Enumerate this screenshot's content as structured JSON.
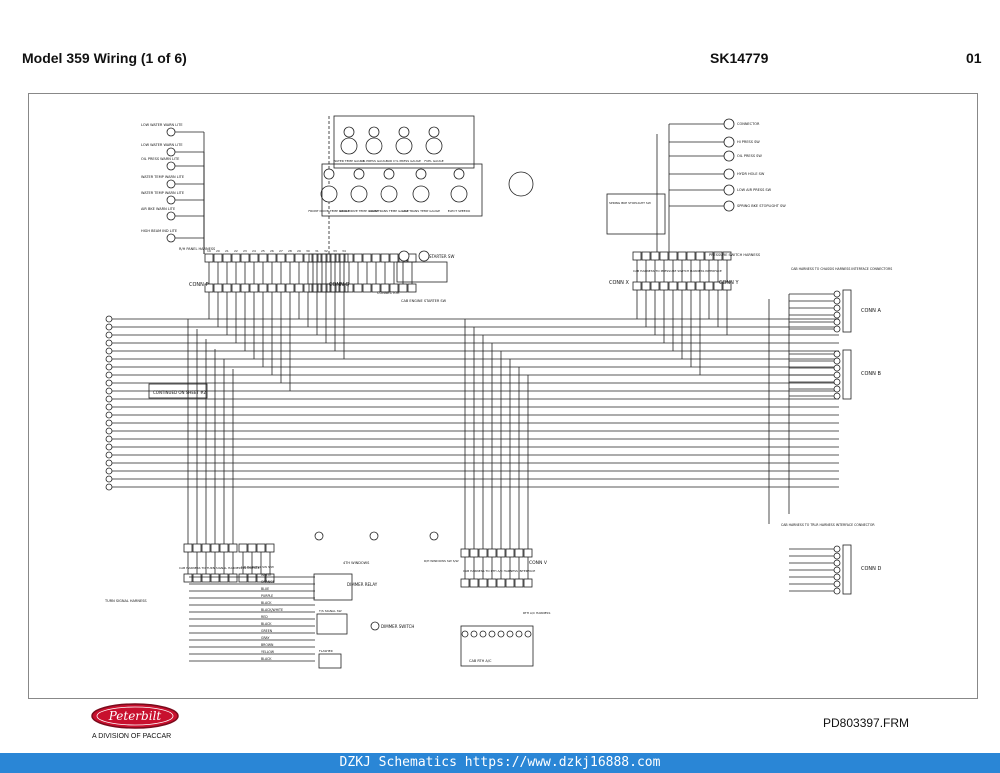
{
  "header": {
    "title": "Model 359 Wiring (1 of 6)",
    "code": "SK14779",
    "page": "01"
  },
  "brand": {
    "logo_text": "Peterbilt",
    "division": "A DIVISION OF PACCAR"
  },
  "file_name": "PD803397.FRM",
  "footer": "DZKJ Schematics https://www.dzkj16888.com",
  "schematic": {
    "left_labels": [
      "LOW WATER WARN LITE",
      "LOW WATER WARN LITE",
      "OIL PRESS WARN LITE",
      "WATER TEMP WARN LITE",
      "WATER TEMP WARN LITE",
      "AIR BKE WARN LITE",
      "HIGH BEAM IND LITE",
      "R/H PANEL HARNESS"
    ],
    "gauges": [
      "WATER TEMP GAUGE",
      "OIL PRESS GAUGE",
      "AIR CYL PRESS GAUGE",
      "FUEL GAUGE"
    ],
    "gauges_row2": [
      "FRONT DRIVE TEMP GAUGE",
      "REAR DRIVE TEMP GAUGE",
      "MAIN TRANS TEMP GAUGE",
      "AUX TRANS TEMP GAUGE",
      "ELECT SPEEDO"
    ],
    "conn_labels": [
      "CONN P",
      "CONN Q",
      "CONN X",
      "CONN Y",
      "CONN V"
    ],
    "right_conn_labels": [
      "CONN A",
      "CONN B",
      "CONN D"
    ],
    "chassis_note": "CAB HARNESS TO CHASSIS HARNESS INTERFACE CONNECTORS",
    "trailer_note": "CAB HARNESS TO TRLR HARNESS INTERFACE CONNECTOR",
    "continued_note": "CONTINUED ON SHEET #2",
    "starter": [
      "STARTER SW",
      "CAB ENGINE STARTER SW",
      "CONNECTOR"
    ],
    "right_top_labels": [
      "CONNECTOR",
      "HI PRESS SW",
      "OIL PRESS SW",
      "HYDR HOLE SW",
      "LOW AIR PRESS SW",
      "SPRING BKE STOPLIGHT SW",
      "PRESSURE SWITCH HARNESS",
      "CAB HARNESS TO PRESSURE SWITCH HARNESS INTERFACE"
    ],
    "bottom_left": [
      "CAB HARNESS TO TURN SIGNAL HARNESS INTERFACE",
      "TURN SIGNAL HARNESS",
      "L/H HARNESS SW S/W",
      "DIMMER RELAY",
      "DIMMER SWITCH",
      "FLASHER",
      "T/S SIGNAL SW"
    ],
    "wire_colors": [
      "WHITE",
      "ORANGE",
      "BLUE",
      "PURPLE",
      "BLACK",
      "BLACK/WHITE",
      "RED",
      "BLACK",
      "GREEN",
      "GRAY",
      "BROWN",
      "YELLOW",
      "BLACK"
    ],
    "bottom_center": [
      "4TH WINDOWS",
      "R/H WINDOWS SW S/W",
      "CAB HARNESS TO RTH A/C HARNESS INTERFACE",
      "RTH A/C HARNESS",
      "CAB RTH A/C"
    ],
    "cavity_numbers": [
      "19",
      "20",
      "21",
      "22",
      "23",
      "24",
      "25",
      "26",
      "27",
      "28",
      "29",
      "30",
      "31",
      "32",
      "33",
      "34",
      "35",
      "36",
      "37",
      "38"
    ]
  }
}
